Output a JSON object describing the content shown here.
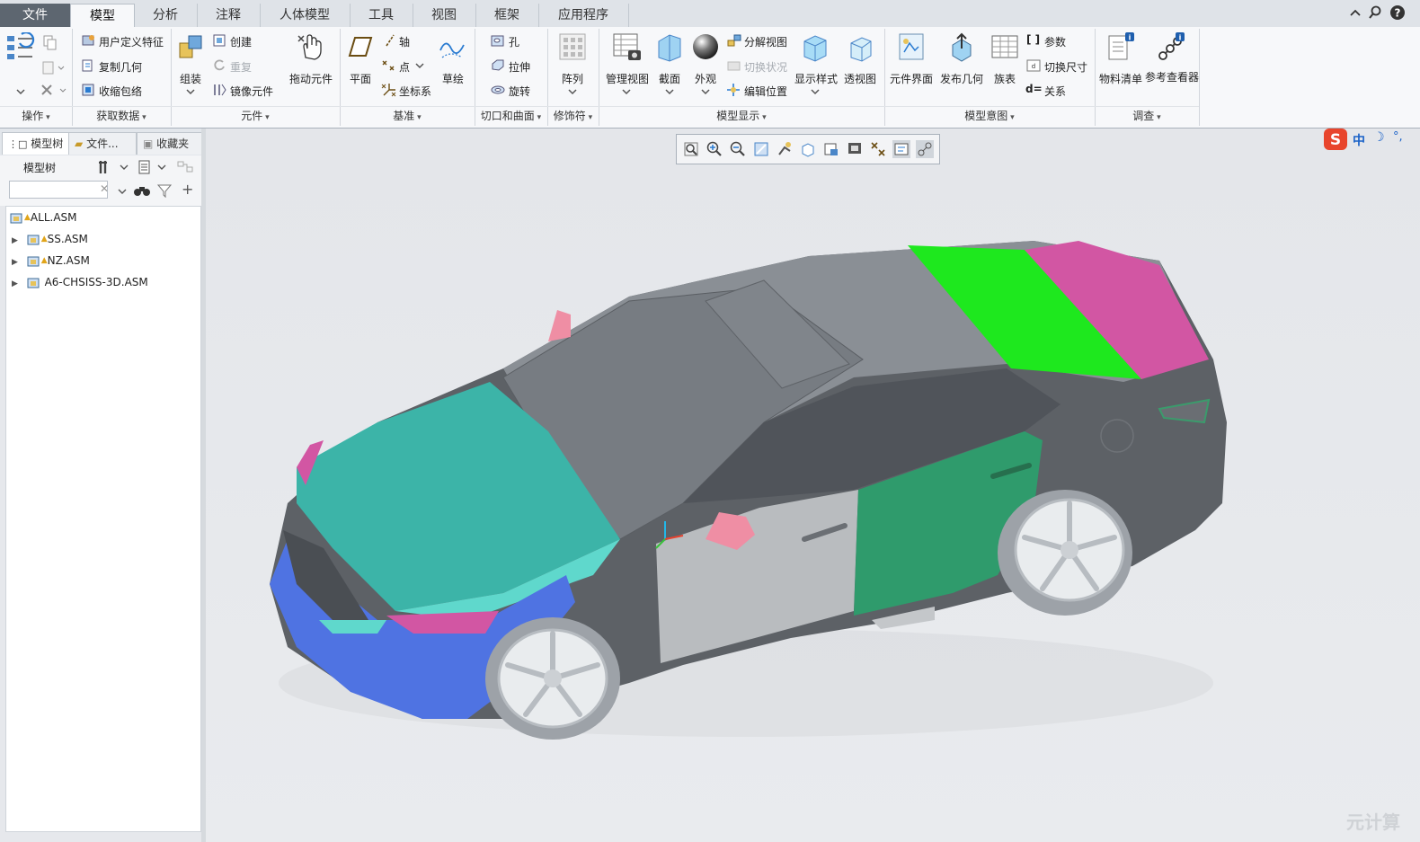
{
  "tabs": [
    "文件",
    "模型",
    "分析",
    "注释",
    "人体模型",
    "工具",
    "视图",
    "框架",
    "应用程序"
  ],
  "active_tab": "模型",
  "groups": {
    "ops": {
      "label": "操作"
    },
    "get_data": {
      "label": "获取数据",
      "items": [
        "用户定义特征",
        "复制几何",
        "收缩包络"
      ]
    },
    "component": {
      "label": "元件",
      "assemble": "组装",
      "create": "创建",
      "repeat": "重复",
      "mirror": "镜像元件",
      "drag": "拖动元件"
    },
    "datum": {
      "label": "基准",
      "plane": "平面",
      "axis": "轴",
      "point": "点",
      "csys": "坐标系",
      "sketch": "草绘"
    },
    "cut": {
      "label": "切口和曲面",
      "hole": "孔",
      "extrude": "拉伸",
      "revolve": "旋转"
    },
    "modifier": {
      "label": "修饰符",
      "pattern": "阵列"
    },
    "display": {
      "label": "模型显示",
      "manage_view": "管理视图",
      "section": "截面",
      "appearance": "外观",
      "exploded": "分解视图",
      "toggle_status": "切换状况",
      "edit_position": "编辑位置",
      "display_style": "显示样式",
      "perspective": "透视图"
    },
    "intent": {
      "label": "模型意图",
      "component_interface": "元件界面",
      "publish_geom": "发布几何",
      "family_table": "族表",
      "params": "参数",
      "switch_dims": "切换尺寸",
      "relations": "关系"
    },
    "investigate": {
      "label": "调查",
      "bom": "物料清单",
      "ref_viewer": "参考查看器"
    }
  },
  "panel": {
    "tabs": [
      "模型树",
      "文件...",
      "收藏夹"
    ],
    "title": "模型树",
    "search_placeholder": "",
    "tree": [
      "ALL.ASM",
      "SS.ASM",
      "NZ.ASM",
      "A6-CHSISS-3D.ASM"
    ]
  },
  "ime": {
    "cn": "中"
  },
  "watermark": "元计算",
  "colors": {
    "hood": "#3cb4a8",
    "bumper": "#4f73e2",
    "door_front": "#b9bcbf",
    "door_rear": "#2f9b6c",
    "roof_green": "#1ee81e",
    "tail": "#d256a3",
    "body": "#5d6166",
    "mirror": "#ef8ea4"
  }
}
